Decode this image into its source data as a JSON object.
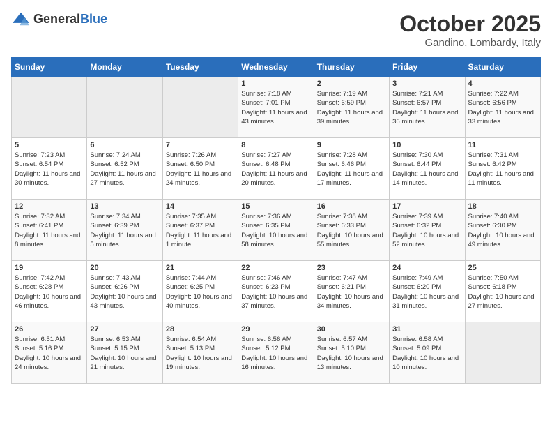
{
  "header": {
    "logo_general": "General",
    "logo_blue": "Blue",
    "month": "October 2025",
    "location": "Gandino, Lombardy, Italy"
  },
  "days_of_week": [
    "Sunday",
    "Monday",
    "Tuesday",
    "Wednesday",
    "Thursday",
    "Friday",
    "Saturday"
  ],
  "weeks": [
    [
      {
        "day": "",
        "empty": true
      },
      {
        "day": "",
        "empty": true
      },
      {
        "day": "",
        "empty": true
      },
      {
        "day": "1",
        "sunrise": "7:18 AM",
        "sunset": "7:01 PM",
        "daylight": "11 hours and 43 minutes."
      },
      {
        "day": "2",
        "sunrise": "7:19 AM",
        "sunset": "6:59 PM",
        "daylight": "11 hours and 39 minutes."
      },
      {
        "day": "3",
        "sunrise": "7:21 AM",
        "sunset": "6:57 PM",
        "daylight": "11 hours and 36 minutes."
      },
      {
        "day": "4",
        "sunrise": "7:22 AM",
        "sunset": "6:56 PM",
        "daylight": "11 hours and 33 minutes."
      }
    ],
    [
      {
        "day": "5",
        "sunrise": "7:23 AM",
        "sunset": "6:54 PM",
        "daylight": "11 hours and 30 minutes."
      },
      {
        "day": "6",
        "sunrise": "7:24 AM",
        "sunset": "6:52 PM",
        "daylight": "11 hours and 27 minutes."
      },
      {
        "day": "7",
        "sunrise": "7:26 AM",
        "sunset": "6:50 PM",
        "daylight": "11 hours and 24 minutes."
      },
      {
        "day": "8",
        "sunrise": "7:27 AM",
        "sunset": "6:48 PM",
        "daylight": "11 hours and 20 minutes."
      },
      {
        "day": "9",
        "sunrise": "7:28 AM",
        "sunset": "6:46 PM",
        "daylight": "11 hours and 17 minutes."
      },
      {
        "day": "10",
        "sunrise": "7:30 AM",
        "sunset": "6:44 PM",
        "daylight": "11 hours and 14 minutes."
      },
      {
        "day": "11",
        "sunrise": "7:31 AM",
        "sunset": "6:42 PM",
        "daylight": "11 hours and 11 minutes."
      }
    ],
    [
      {
        "day": "12",
        "sunrise": "7:32 AM",
        "sunset": "6:41 PM",
        "daylight": "11 hours and 8 minutes."
      },
      {
        "day": "13",
        "sunrise": "7:34 AM",
        "sunset": "6:39 PM",
        "daylight": "11 hours and 5 minutes."
      },
      {
        "day": "14",
        "sunrise": "7:35 AM",
        "sunset": "6:37 PM",
        "daylight": "11 hours and 1 minute."
      },
      {
        "day": "15",
        "sunrise": "7:36 AM",
        "sunset": "6:35 PM",
        "daylight": "10 hours and 58 minutes."
      },
      {
        "day": "16",
        "sunrise": "7:38 AM",
        "sunset": "6:33 PM",
        "daylight": "10 hours and 55 minutes."
      },
      {
        "day": "17",
        "sunrise": "7:39 AM",
        "sunset": "6:32 PM",
        "daylight": "10 hours and 52 minutes."
      },
      {
        "day": "18",
        "sunrise": "7:40 AM",
        "sunset": "6:30 PM",
        "daylight": "10 hours and 49 minutes."
      }
    ],
    [
      {
        "day": "19",
        "sunrise": "7:42 AM",
        "sunset": "6:28 PM",
        "daylight": "10 hours and 46 minutes."
      },
      {
        "day": "20",
        "sunrise": "7:43 AM",
        "sunset": "6:26 PM",
        "daylight": "10 hours and 43 minutes."
      },
      {
        "day": "21",
        "sunrise": "7:44 AM",
        "sunset": "6:25 PM",
        "daylight": "10 hours and 40 minutes."
      },
      {
        "day": "22",
        "sunrise": "7:46 AM",
        "sunset": "6:23 PM",
        "daylight": "10 hours and 37 minutes."
      },
      {
        "day": "23",
        "sunrise": "7:47 AM",
        "sunset": "6:21 PM",
        "daylight": "10 hours and 34 minutes."
      },
      {
        "day": "24",
        "sunrise": "7:49 AM",
        "sunset": "6:20 PM",
        "daylight": "10 hours and 31 minutes."
      },
      {
        "day": "25",
        "sunrise": "7:50 AM",
        "sunset": "6:18 PM",
        "daylight": "10 hours and 27 minutes."
      }
    ],
    [
      {
        "day": "26",
        "sunrise": "6:51 AM",
        "sunset": "5:16 PM",
        "daylight": "10 hours and 24 minutes."
      },
      {
        "day": "27",
        "sunrise": "6:53 AM",
        "sunset": "5:15 PM",
        "daylight": "10 hours and 21 minutes."
      },
      {
        "day": "28",
        "sunrise": "6:54 AM",
        "sunset": "5:13 PM",
        "daylight": "10 hours and 19 minutes."
      },
      {
        "day": "29",
        "sunrise": "6:56 AM",
        "sunset": "5:12 PM",
        "daylight": "10 hours and 16 minutes."
      },
      {
        "day": "30",
        "sunrise": "6:57 AM",
        "sunset": "5:10 PM",
        "daylight": "10 hours and 13 minutes."
      },
      {
        "day": "31",
        "sunrise": "6:58 AM",
        "sunset": "5:09 PM",
        "daylight": "10 hours and 10 minutes."
      },
      {
        "day": "",
        "empty": true
      }
    ]
  ],
  "labels": {
    "sunrise": "Sunrise:",
    "sunset": "Sunset:",
    "daylight": "Daylight:"
  }
}
